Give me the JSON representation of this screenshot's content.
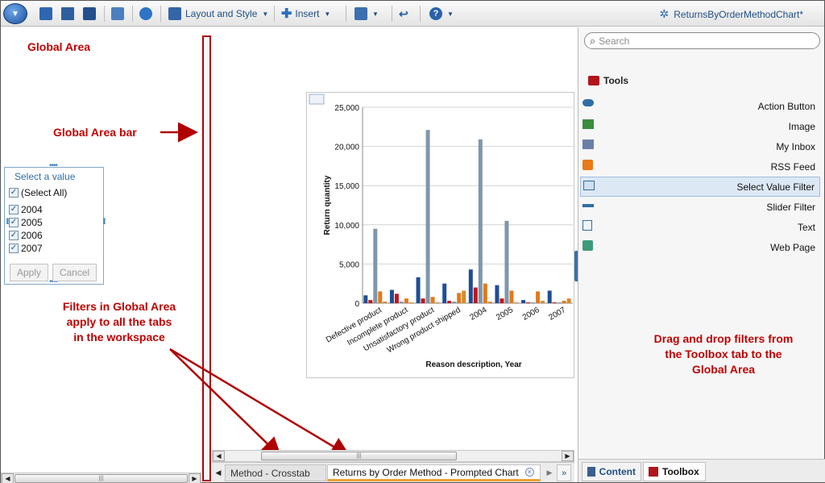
{
  "toolbar": {
    "layout_label": "Layout and Style",
    "insert_label": "Insert",
    "doc_title": "ReturnsByOrderMethodChart*"
  },
  "global_area": {
    "title": "Global Area",
    "bar_label": "Global Area bar",
    "note_line1": "Filters in Global Area",
    "note_line2": "apply to all the tabs",
    "note_line3": "in the workspace"
  },
  "filter": {
    "title": "Select a value",
    "select_all": "(Select All)",
    "years": [
      "2004",
      "2005",
      "2006",
      "2007"
    ],
    "apply": "Apply",
    "cancel": "Cancel"
  },
  "tabs": {
    "tab1": "Method - Crosstab",
    "tab2": "Returns by Order Method - Prompted Chart"
  },
  "right_panel": {
    "search_placeholder": "Search",
    "tools_title": "Tools",
    "tools": [
      "Action Button",
      "Image",
      "My Inbox",
      "RSS Feed",
      "Select Value Filter",
      "Slider Filter",
      "Text",
      "Web Page"
    ],
    "selected_tool": "Select Value Filter",
    "note_line1": "Drag and drop filters from",
    "note_line2": "the Toolbox tab to the",
    "note_line3": "Global Area",
    "tab_content": "Content",
    "tab_toolbox": "Toolbox"
  },
  "chart_data": {
    "type": "bar",
    "ylabel": "Return quantity",
    "xlabel": "Reason description, Year",
    "ylim": [
      0,
      25000
    ],
    "yticks": [
      "0",
      "5,000",
      "10,000",
      "15,000",
      "20,000",
      "25,000"
    ],
    "categories": [
      "Defective product",
      "Incomplete product",
      "Unsatisfactory product",
      "Wrong product shipped",
      "2004",
      "2005",
      "2006",
      "2007"
    ],
    "series": [
      {
        "color": "#1f4e96",
        "values": [
          1000,
          1700,
          3300,
          2500,
          4300,
          2300,
          400,
          1600
        ]
      },
      {
        "color": "#c0171c",
        "values": [
          400,
          1200,
          600,
          300,
          2000,
          600,
          100,
          100
        ]
      },
      {
        "color": "#7f97ac",
        "values": [
          9500,
          200,
          22100,
          200,
          20900,
          10500,
          100,
          100
        ]
      },
      {
        "color": "#e07a1c",
        "values": [
          1500,
          600,
          800,
          1300,
          2500,
          1600,
          1500,
          300
        ]
      },
      {
        "color": "#d98a2f",
        "values": [
          200,
          100,
          100,
          1600,
          200,
          100,
          300,
          600
        ]
      }
    ]
  },
  "colors": {
    "annotation": "#c00000",
    "accent": "#1f4f86",
    "ga_bar": "#b00000"
  }
}
